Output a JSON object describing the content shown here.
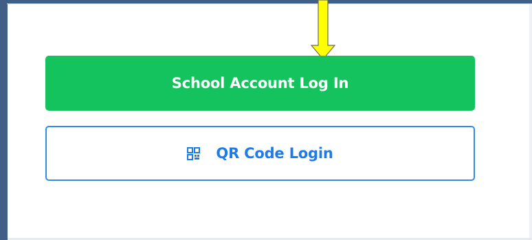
{
  "login_options": {
    "school_account_label": "School Account Log In",
    "qr_code_label": "QR Code Login",
    "qr_icon": "qr-code-icon"
  },
  "annotation": {
    "arrow_icon": "arrow-down-icon",
    "arrow_color": "#ffff00"
  },
  "colors": {
    "primary_green": "#14c35e",
    "accent_blue": "#1f7be8",
    "frame_blue": "#3f5f86"
  }
}
